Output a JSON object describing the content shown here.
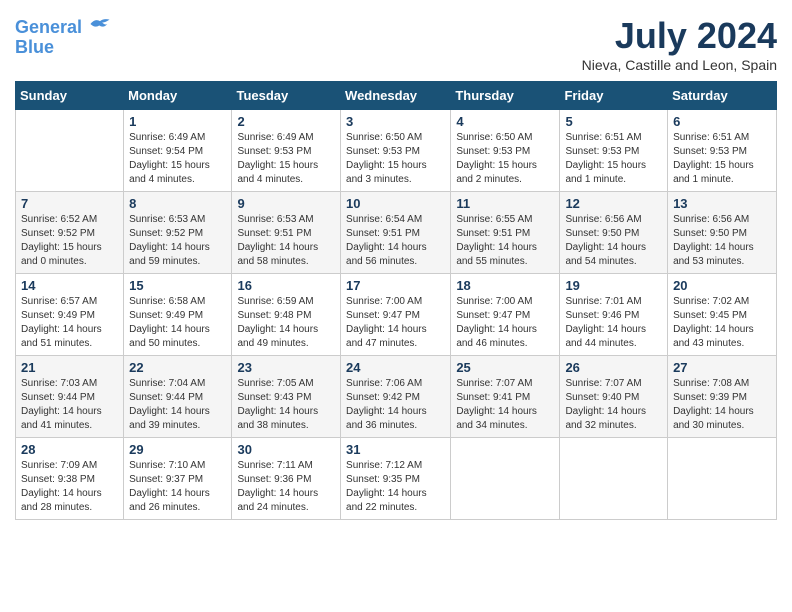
{
  "header": {
    "logo_line1": "General",
    "logo_line2": "Blue",
    "month_title": "July 2024",
    "location": "Nieva, Castille and Leon, Spain"
  },
  "calendar": {
    "weekdays": [
      "Sunday",
      "Monday",
      "Tuesday",
      "Wednesday",
      "Thursday",
      "Friday",
      "Saturday"
    ],
    "weeks": [
      [
        {
          "day": "",
          "info": ""
        },
        {
          "day": "1",
          "info": "Sunrise: 6:49 AM\nSunset: 9:54 PM\nDaylight: 15 hours\nand 4 minutes."
        },
        {
          "day": "2",
          "info": "Sunrise: 6:49 AM\nSunset: 9:53 PM\nDaylight: 15 hours\nand 4 minutes."
        },
        {
          "day": "3",
          "info": "Sunrise: 6:50 AM\nSunset: 9:53 PM\nDaylight: 15 hours\nand 3 minutes."
        },
        {
          "day": "4",
          "info": "Sunrise: 6:50 AM\nSunset: 9:53 PM\nDaylight: 15 hours\nand 2 minutes."
        },
        {
          "day": "5",
          "info": "Sunrise: 6:51 AM\nSunset: 9:53 PM\nDaylight: 15 hours\nand 1 minute."
        },
        {
          "day": "6",
          "info": "Sunrise: 6:51 AM\nSunset: 9:53 PM\nDaylight: 15 hours\nand 1 minute."
        }
      ],
      [
        {
          "day": "7",
          "info": "Sunrise: 6:52 AM\nSunset: 9:52 PM\nDaylight: 15 hours\nand 0 minutes."
        },
        {
          "day": "8",
          "info": "Sunrise: 6:53 AM\nSunset: 9:52 PM\nDaylight: 14 hours\nand 59 minutes."
        },
        {
          "day": "9",
          "info": "Sunrise: 6:53 AM\nSunset: 9:51 PM\nDaylight: 14 hours\nand 58 minutes."
        },
        {
          "day": "10",
          "info": "Sunrise: 6:54 AM\nSunset: 9:51 PM\nDaylight: 14 hours\nand 56 minutes."
        },
        {
          "day": "11",
          "info": "Sunrise: 6:55 AM\nSunset: 9:51 PM\nDaylight: 14 hours\nand 55 minutes."
        },
        {
          "day": "12",
          "info": "Sunrise: 6:56 AM\nSunset: 9:50 PM\nDaylight: 14 hours\nand 54 minutes."
        },
        {
          "day": "13",
          "info": "Sunrise: 6:56 AM\nSunset: 9:50 PM\nDaylight: 14 hours\nand 53 minutes."
        }
      ],
      [
        {
          "day": "14",
          "info": "Sunrise: 6:57 AM\nSunset: 9:49 PM\nDaylight: 14 hours\nand 51 minutes."
        },
        {
          "day": "15",
          "info": "Sunrise: 6:58 AM\nSunset: 9:49 PM\nDaylight: 14 hours\nand 50 minutes."
        },
        {
          "day": "16",
          "info": "Sunrise: 6:59 AM\nSunset: 9:48 PM\nDaylight: 14 hours\nand 49 minutes."
        },
        {
          "day": "17",
          "info": "Sunrise: 7:00 AM\nSunset: 9:47 PM\nDaylight: 14 hours\nand 47 minutes."
        },
        {
          "day": "18",
          "info": "Sunrise: 7:00 AM\nSunset: 9:47 PM\nDaylight: 14 hours\nand 46 minutes."
        },
        {
          "day": "19",
          "info": "Sunrise: 7:01 AM\nSunset: 9:46 PM\nDaylight: 14 hours\nand 44 minutes."
        },
        {
          "day": "20",
          "info": "Sunrise: 7:02 AM\nSunset: 9:45 PM\nDaylight: 14 hours\nand 43 minutes."
        }
      ],
      [
        {
          "day": "21",
          "info": "Sunrise: 7:03 AM\nSunset: 9:44 PM\nDaylight: 14 hours\nand 41 minutes."
        },
        {
          "day": "22",
          "info": "Sunrise: 7:04 AM\nSunset: 9:44 PM\nDaylight: 14 hours\nand 39 minutes."
        },
        {
          "day": "23",
          "info": "Sunrise: 7:05 AM\nSunset: 9:43 PM\nDaylight: 14 hours\nand 38 minutes."
        },
        {
          "day": "24",
          "info": "Sunrise: 7:06 AM\nSunset: 9:42 PM\nDaylight: 14 hours\nand 36 minutes."
        },
        {
          "day": "25",
          "info": "Sunrise: 7:07 AM\nSunset: 9:41 PM\nDaylight: 14 hours\nand 34 minutes."
        },
        {
          "day": "26",
          "info": "Sunrise: 7:07 AM\nSunset: 9:40 PM\nDaylight: 14 hours\nand 32 minutes."
        },
        {
          "day": "27",
          "info": "Sunrise: 7:08 AM\nSunset: 9:39 PM\nDaylight: 14 hours\nand 30 minutes."
        }
      ],
      [
        {
          "day": "28",
          "info": "Sunrise: 7:09 AM\nSunset: 9:38 PM\nDaylight: 14 hours\nand 28 minutes."
        },
        {
          "day": "29",
          "info": "Sunrise: 7:10 AM\nSunset: 9:37 PM\nDaylight: 14 hours\nand 26 minutes."
        },
        {
          "day": "30",
          "info": "Sunrise: 7:11 AM\nSunset: 9:36 PM\nDaylight: 14 hours\nand 24 minutes."
        },
        {
          "day": "31",
          "info": "Sunrise: 7:12 AM\nSunset: 9:35 PM\nDaylight: 14 hours\nand 22 minutes."
        },
        {
          "day": "",
          "info": ""
        },
        {
          "day": "",
          "info": ""
        },
        {
          "day": "",
          "info": ""
        }
      ]
    ]
  }
}
